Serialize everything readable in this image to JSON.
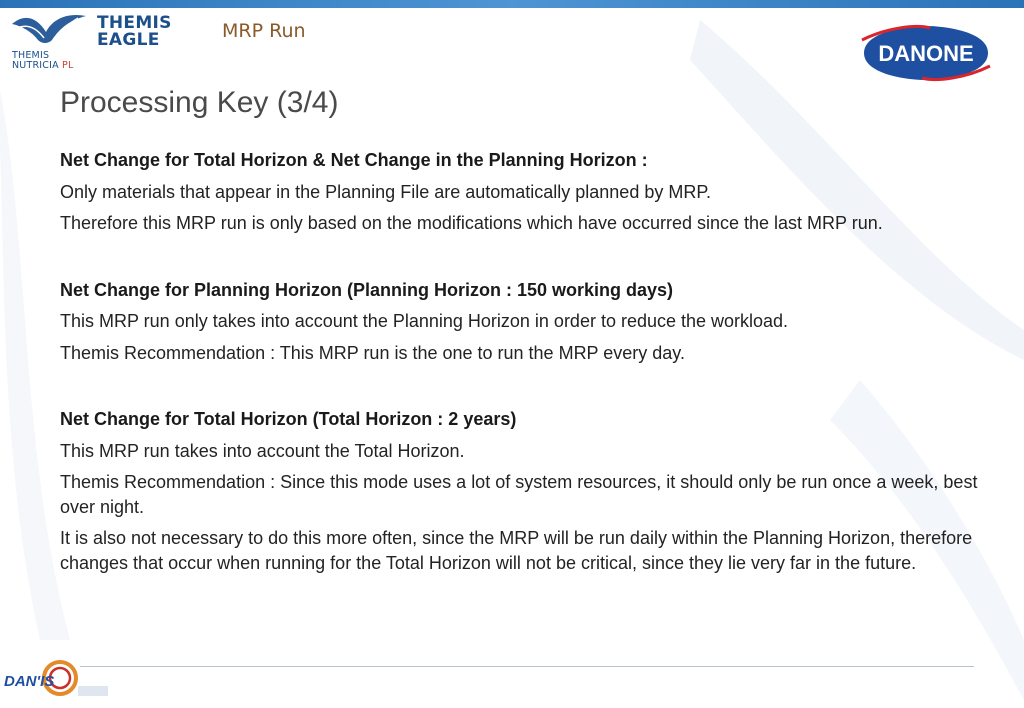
{
  "header": {
    "topic": "MRP Run",
    "logo_left": {
      "wordmark_line1": "THEMIS",
      "wordmark_line2": "EAGLE",
      "sub_line1": "THEMIS",
      "sub_line2": "NUTRICIA",
      "sub_line2_suffix": " PL"
    },
    "logo_right": "DANONE"
  },
  "title": "Processing Key (3/4)",
  "sections": [
    {
      "heading": "Net Change for Total Horizon & Net Change in the Planning Horizon :",
      "paragraphs": [
        "Only materials that appear in the Planning File are automatically planned by MRP.",
        "Therefore this MRP run is only based on the modifications which have occurred since the last MRP run."
      ]
    },
    {
      "heading": "Net Change for Planning Horizon (Planning Horizon : 150 working days)",
      "paragraphs": [
        "This MRP run only takes into account the Planning Horizon in order to reduce the workload.",
        "Themis Recommendation : This MRP run is the one to run the MRP every day."
      ]
    },
    {
      "heading": "Net Change for Total Horizon (Total Horizon : 2 years)",
      "paragraphs": [
        "This MRP run takes into account the Total Horizon.",
        "Themis Recommendation : Since this mode uses a lot of system resources, it should only be run once a week, best over night.",
        "It is also not necessary to do this more often, since the MRP will be run daily within the Planning Horizon, therefore changes that occur when running for the Total Horizon will not be critical, since they lie very far in the future."
      ]
    }
  ],
  "footer": {
    "logo": "DAN'IS"
  },
  "colors": {
    "accent_blue": "#2a73b8",
    "danone_blue": "#1e4fa0",
    "danone_red": "#d9262d",
    "header_brown": "#8a5a2a"
  }
}
